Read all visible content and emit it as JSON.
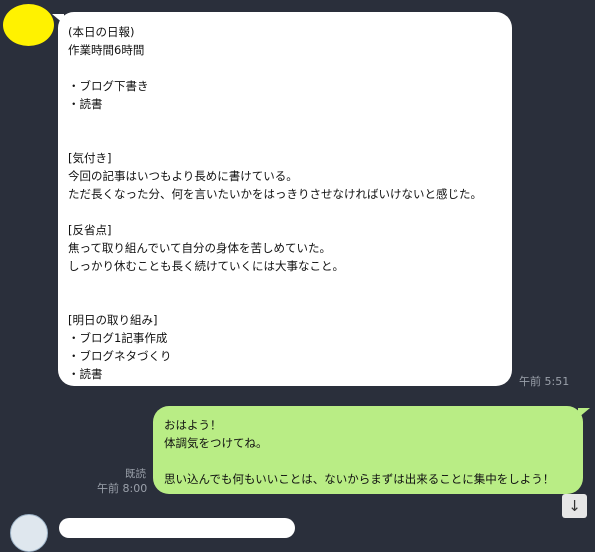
{
  "incoming": {
    "lines": [
      "(本日の日報)",
      "作業時間6時間",
      "",
      "・ブログ下書き",
      "・読書",
      "",
      "",
      "[気付き]",
      "今回の記事はいつもより長めに書けている。",
      "ただ長くなった分、何を言いたいかをはっきりさせなければいけないと感じた。",
      "",
      "[反省点]",
      "焦って取り組んでいて自分の身体を苦しめていた。",
      "しっかり休むことも長く続けていくには大事なこと。",
      "",
      "",
      "[明日の取り組み]",
      "・ブログ1記事作成",
      "・ブログネタづくり",
      "・読書"
    ],
    "time": "午前 5:51"
  },
  "outgoing": {
    "lines": [
      "おはよう！",
      "体調気をつけてね。",
      "",
      "思い込んでも何もいいことは、ないからまずは出来ることに集中をしよう！"
    ],
    "read_label": "既読",
    "time": "午前 8:00"
  },
  "scroll_down_icon": "↓",
  "colors": {
    "background": "#2a2f3b",
    "incoming_bubble": "#ffffff",
    "outgoing_bubble": "#b9ed85",
    "avatar": "#fff200"
  }
}
